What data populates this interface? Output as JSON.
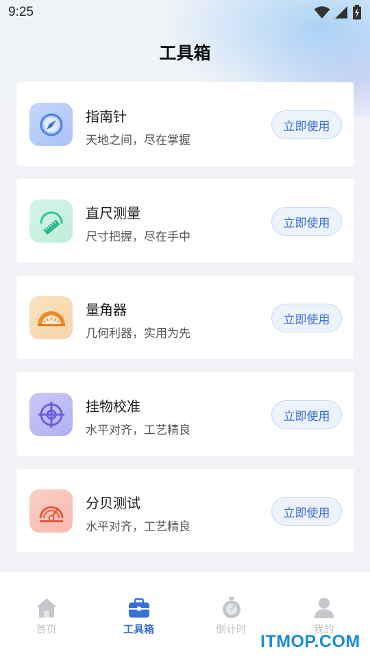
{
  "status_bar": {
    "time": "9:25"
  },
  "header": {
    "title": "工具箱"
  },
  "tools": [
    {
      "name": "compass",
      "title": "指南针",
      "subtitle": "天地之间，尽在掌握",
      "button": "立即使用",
      "icon": "compass-icon",
      "icon_bg": "#b8cdf8"
    },
    {
      "name": "ruler",
      "title": "直尺测量",
      "subtitle": "尺寸把握，尽在手中",
      "button": "立即使用",
      "icon": "ruler-icon",
      "icon_bg": "#c9f0e0"
    },
    {
      "name": "protractor",
      "title": "量角器",
      "subtitle": "几何利器，实用为先",
      "button": "立即使用",
      "icon": "protractor-icon",
      "icon_bg": "#f8dcb4"
    },
    {
      "name": "level",
      "title": "挂物校准",
      "subtitle": "水平对齐，工艺精良",
      "button": "立即使用",
      "icon": "crosshair-icon",
      "icon_bg": "#c2c0f6"
    },
    {
      "name": "decibel",
      "title": "分贝测试",
      "subtitle": "水平对齐，工艺精良",
      "button": "立即使用",
      "icon": "gauge-icon",
      "icon_bg": "#f9c6bc"
    }
  ],
  "tab_bar": {
    "items": [
      {
        "label": "首页",
        "icon": "home-icon",
        "active": false
      },
      {
        "label": "工具箱",
        "icon": "toolbox-icon",
        "active": true
      },
      {
        "label": "倒计时",
        "icon": "stopwatch-icon",
        "active": false
      },
      {
        "label": "我的",
        "icon": "user-icon",
        "active": false
      }
    ]
  },
  "watermark": "ITMOP.COM",
  "colors": {
    "accent": "#3a6fd8",
    "background": "#f1f3f7",
    "inactive_tab": "#bfc3c9"
  }
}
